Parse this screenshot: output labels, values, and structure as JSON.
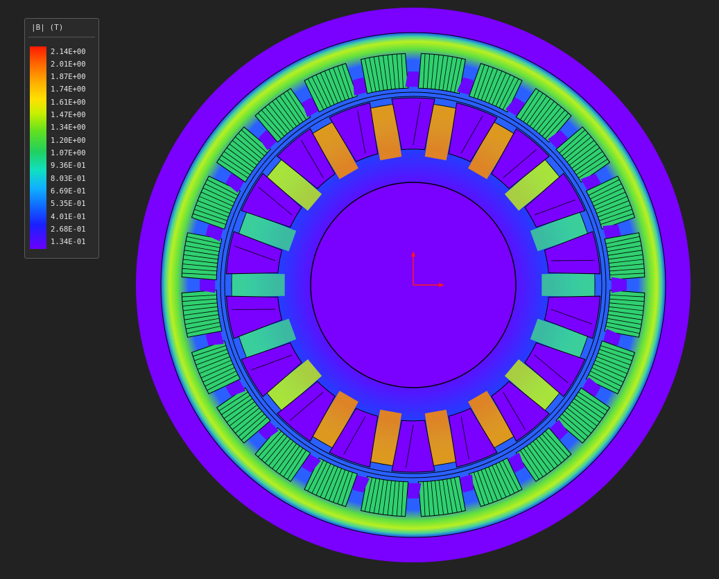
{
  "legend": {
    "title": "|B| (T)",
    "labels": [
      "2.14E+00",
      "2.01E+00",
      "1.87E+00",
      "1.74E+00",
      "1.61E+00",
      "1.47E+00",
      "1.34E+00",
      "1.20E+00",
      "1.07E+00",
      "9.36E-01",
      "8.03E-01",
      "6.69E-01",
      "5.35E-01",
      "4.01E-01",
      "2.68E-01",
      "1.34E-01"
    ]
  },
  "model": {
    "stator_slots": 24,
    "rotor_slots": 18
  },
  "colors": {
    "background": "#222222",
    "low_field": "#7a00ff",
    "high_field": "#ff2000",
    "axis": "#ff1a1a",
    "line": "#000000"
  }
}
